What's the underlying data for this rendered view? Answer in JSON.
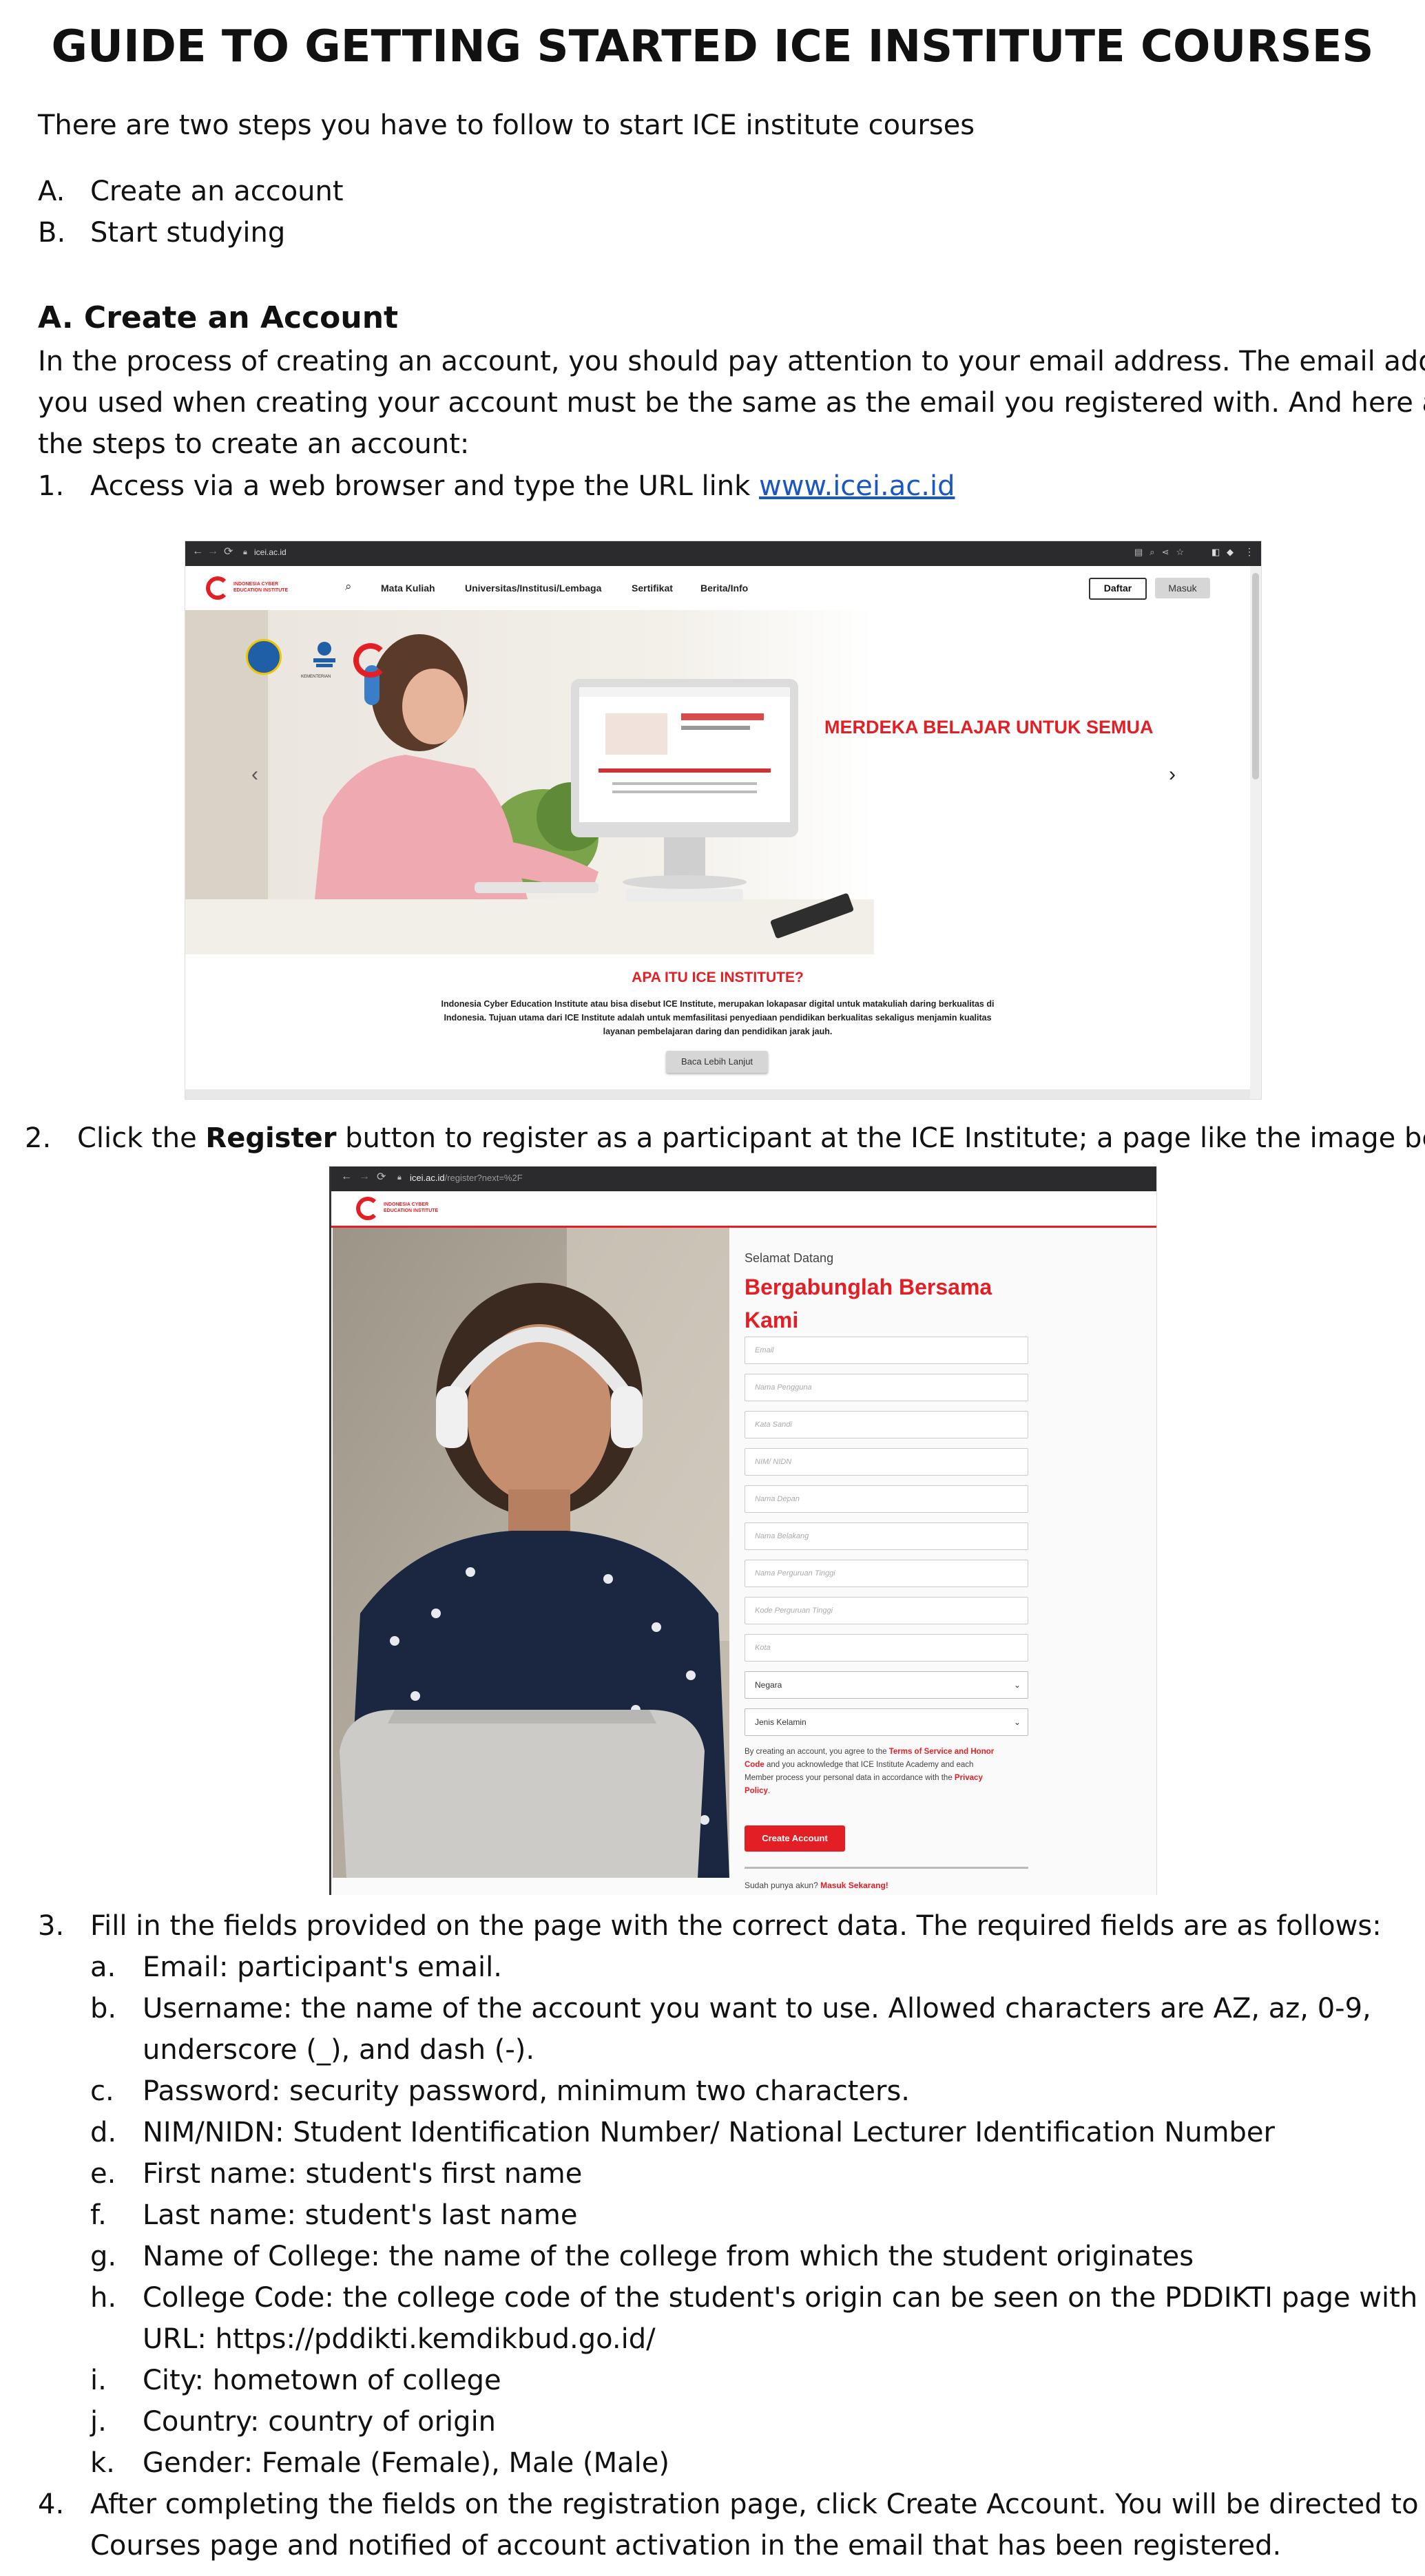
{
  "title": "GUIDE TO GETTING STARTED ICE INSTITUTE COURSES",
  "intro": "There are two steps you have to follow to start ICE institute courses",
  "steps_overview": [
    {
      "marker": "A.",
      "text": "Create an account"
    },
    {
      "marker": "B.",
      "text": "Start studying"
    }
  ],
  "section_a": {
    "heading": "A. Create an Account",
    "para_lines": [
      "In the process of creating an account, you should pay attention to your email address. The email address",
      "you used when creating your account must be the same as the email you registered with. And here are",
      "the steps to create an account:"
    ]
  },
  "step1": {
    "marker": "1.",
    "text": "Access via a web browser and type the URL link ",
    "link": "www.icei.ac.id"
  },
  "screenshot1": {
    "url": "icei.ac.id",
    "nav": [
      "Mata Kuliah",
      "Universitas/Institusi/Lembaga",
      "Sertifikat",
      "Berita/Info"
    ],
    "logo_lines": [
      "INDONESIA CYBER",
      "EDUCATION INSTITUTE"
    ],
    "ministry_caption": "KEMENTERIAN",
    "btn_daftar": "Daftar",
    "btn_masuk": "Masuk",
    "hero_slogan": "MERDEKA BELAJAR UNTUK SEMUA",
    "about_title": "APA ITU ICE INSTITUTE?",
    "about_lines": [
      "Indonesia Cyber Education Institute atau bisa disebut ICE Institute, merupakan lokapasar digital untuk matakuliah daring berkualitas di",
      "Indonesia. Tujuan utama dari ICE Institute adalah untuk memfasilitasi penyediaan pendidikan berkualitas sekaligus menjamin kualitas",
      "layanan pembelajaran daring dan pendidikan jarak jauh."
    ],
    "read_more": "Baca Lebih Lanjut",
    "arrow_left": "‹",
    "arrow_right": "›"
  },
  "step2": {
    "marker": "2.",
    "pre": "Click the ",
    "bold": "Register",
    "post": " button to register as a participant at the ICE Institute; a page like the image below"
  },
  "screenshot2": {
    "url_host": "icei.ac.id",
    "url_path": "/register?next=%2F",
    "logo_lines": [
      "INDONESIA CYBER",
      "EDUCATION INSTITUTE"
    ],
    "welcome": "Selamat Datang",
    "heading_line1": "Bergabunglah Bersama",
    "heading_line2": "Kami",
    "fields": [
      "Email",
      "Nama Pengguna",
      "Kata Sandi",
      "NIM/ NIDN",
      "Nama Depan",
      "Nama Belakang",
      "Nama Perguruan Tinggi",
      "Kode Perguruan Tinggi",
      "Kota"
    ],
    "selects": [
      "Negara",
      "Jenis Kelamin"
    ],
    "terms_lines": [
      {
        "pre": "By creating an account, you agree to the ",
        "red": "Terms of Service and Honor"
      },
      {
        "red": "Code",
        "post": " and you acknowledge that ICE Institute Academy and each"
      },
      {
        "pre": "Member process your personal data in accordance with the ",
        "red": "Privacy"
      },
      {
        "red": "Policy",
        "post": "."
      }
    ],
    "create_button": "Create Account",
    "have_account": "Sudah punya akun? ",
    "login_link": "Masuk Sekarang!"
  },
  "step3": {
    "marker": "3.",
    "text": "Fill in the fields provided on the page with the correct data. The required fields are as follows:"
  },
  "fields_list": [
    {
      "marker": "a.",
      "lines": [
        "Email: participant's email."
      ]
    },
    {
      "marker": "b.",
      "lines": [
        "Username: the name of the account you want to use. Allowed characters are AZ, az, 0-9,",
        "underscore (_), and dash (-)."
      ]
    },
    {
      "marker": "c.",
      "lines": [
        "Password: security password, minimum two characters."
      ]
    },
    {
      "marker": "d.",
      "lines": [
        "NIM/NIDN: Student Identification Number/ National Lecturer Identification Number"
      ]
    },
    {
      "marker": "e.",
      "lines": [
        "First name: student's first name"
      ]
    },
    {
      "marker": "f.",
      "lines": [
        "Last name: student's last name"
      ]
    },
    {
      "marker": "g.",
      "lines": [
        "Name of College: the name of the college from which the student originates"
      ]
    },
    {
      "marker": "h.",
      "lines": [
        "College Code: the college code of the student's origin can be seen on the PDDIKTI page with the",
        "URL: https://pddikti.kemdikbud.go.id/"
      ]
    },
    {
      "marker": "i.",
      "lines": [
        "City: hometown of college"
      ]
    },
    {
      "marker": "j.",
      "lines": [
        "Country: country of origin"
      ]
    },
    {
      "marker": "k.",
      "lines": [
        "Gender: Female (Female), Male (Male)"
      ]
    }
  ],
  "step4": {
    "marker": "4.",
    "lines": [
      "After completing the fields on the registration page, click Create Account. You will be directed to the",
      "Courses page and notified of account activation in the email that has been registered."
    ]
  }
}
